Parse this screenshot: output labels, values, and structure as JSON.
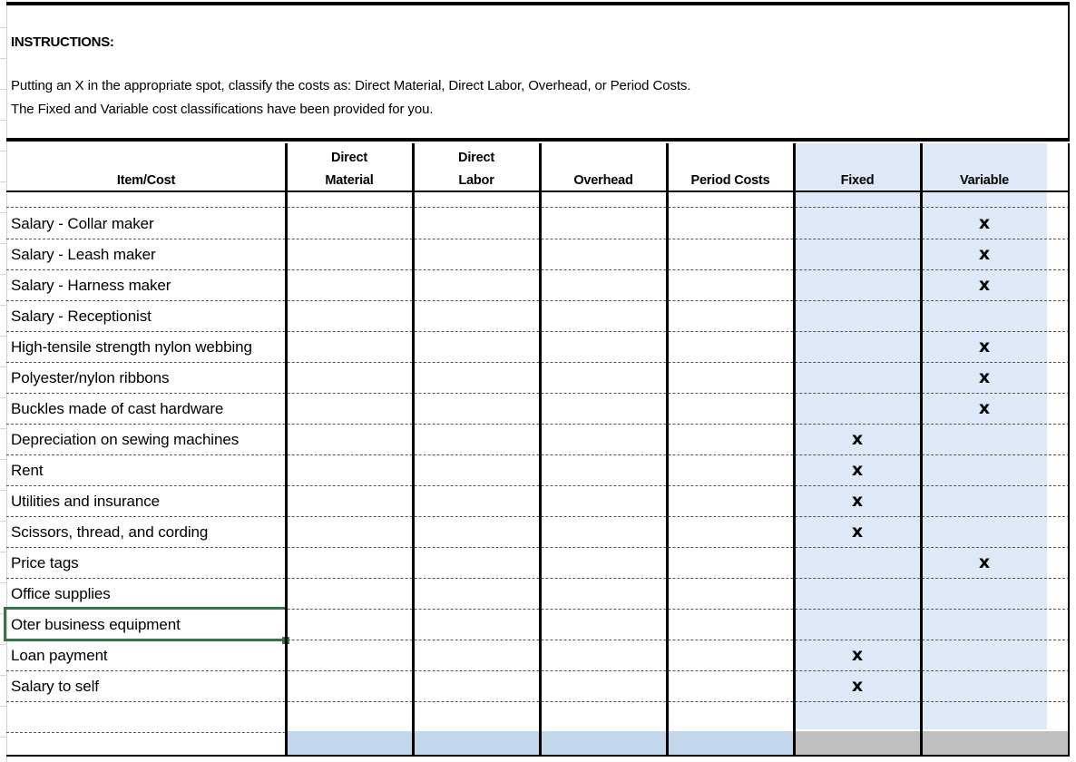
{
  "instructions": {
    "title": "INSTRUCTIONS:",
    "line1": "Putting an X in the appropriate spot, classify the costs as:  Direct Material, Direct Labor, Overhead, or Period Costs.",
    "line2": "The Fixed and Variable cost classifications have been provided for you."
  },
  "table": {
    "headers": {
      "item": "Item/Cost",
      "direct_material_l1": "Direct",
      "direct_material_l2": "Material",
      "direct_labor_l1": "Direct",
      "direct_labor_l2": "Labor",
      "overhead": "Overhead",
      "period_costs": "Period Costs",
      "fixed": "Fixed",
      "variable": "Variable"
    },
    "mark_symbol": "x",
    "rows": [
      {
        "item": "Salary - Collar maker",
        "direct_material": "",
        "direct_labor": "",
        "overhead": "",
        "period_costs": "",
        "fixed": "",
        "variable": "x"
      },
      {
        "item": "Salary - Leash maker",
        "direct_material": "",
        "direct_labor": "",
        "overhead": "",
        "period_costs": "",
        "fixed": "",
        "variable": "x"
      },
      {
        "item": "Salary - Harness maker",
        "direct_material": "",
        "direct_labor": "",
        "overhead": "",
        "period_costs": "",
        "fixed": "",
        "variable": "x"
      },
      {
        "item": "Salary - Receptionist",
        "direct_material": "",
        "direct_labor": "",
        "overhead": "",
        "period_costs": "",
        "fixed": "",
        "variable": ""
      },
      {
        "item": "High-tensile strength nylon webbing",
        "direct_material": "",
        "direct_labor": "",
        "overhead": "",
        "period_costs": "",
        "fixed": "",
        "variable": "x"
      },
      {
        "item": "Polyester/nylon ribbons",
        "direct_material": "",
        "direct_labor": "",
        "overhead": "",
        "period_costs": "",
        "fixed": "",
        "variable": "x"
      },
      {
        "item": "Buckles made of cast hardware",
        "direct_material": "",
        "direct_labor": "",
        "overhead": "",
        "period_costs": "",
        "fixed": "",
        "variable": "x"
      },
      {
        "item": "Depreciation on sewing machines",
        "direct_material": "",
        "direct_labor": "",
        "overhead": "",
        "period_costs": "",
        "fixed": "x",
        "variable": ""
      },
      {
        "item": "Rent",
        "direct_material": "",
        "direct_labor": "",
        "overhead": "",
        "period_costs": "",
        "fixed": "x",
        "variable": ""
      },
      {
        "item": "Utilities and insurance",
        "direct_material": "",
        "direct_labor": "",
        "overhead": "",
        "period_costs": "",
        "fixed": "x",
        "variable": ""
      },
      {
        "item": "Scissors, thread, and cording",
        "direct_material": "",
        "direct_labor": "",
        "overhead": "",
        "period_costs": "",
        "fixed": "x",
        "variable": ""
      },
      {
        "item": "Price tags",
        "direct_material": "",
        "direct_labor": "",
        "overhead": "",
        "period_costs": "",
        "fixed": "",
        "variable": "x"
      },
      {
        "item": "Office supplies",
        "direct_material": "",
        "direct_labor": "",
        "overhead": "",
        "period_costs": "",
        "fixed": "",
        "variable": ""
      },
      {
        "item": "Oter business equipment",
        "direct_material": "",
        "direct_labor": "",
        "overhead": "",
        "period_costs": "",
        "fixed": "",
        "variable": ""
      },
      {
        "item": "Loan payment",
        "direct_material": "",
        "direct_labor": "",
        "overhead": "",
        "period_costs": "",
        "fixed": "x",
        "variable": ""
      },
      {
        "item": "Salary to self",
        "direct_material": "",
        "direct_labor": "",
        "overhead": "",
        "period_costs": "",
        "fixed": "x",
        "variable": ""
      },
      {
        "item": "",
        "direct_material": "",
        "direct_labor": "",
        "overhead": "",
        "period_costs": "",
        "fixed": "",
        "variable": ""
      }
    ],
    "selected_row_index": 13,
    "colors": {
      "fixed_variable_fill": "#dde9f6",
      "total_row_fill_blue": "#c3d7ec",
      "total_row_fill_gray": "#bfbfbf",
      "selection_border": "#3a7148"
    }
  }
}
